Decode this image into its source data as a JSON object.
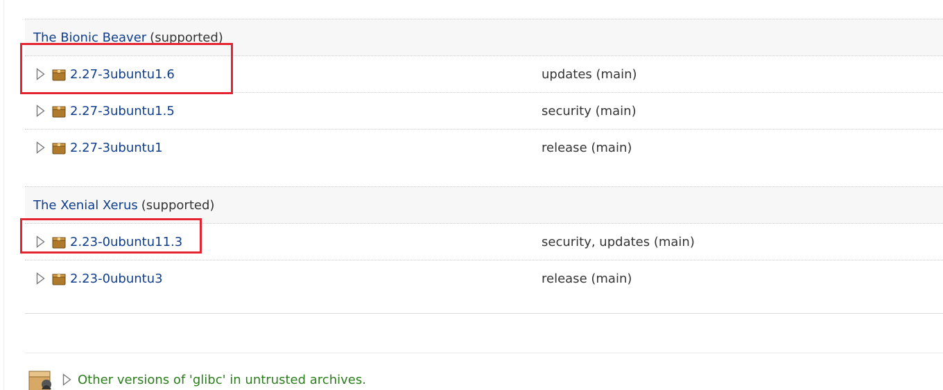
{
  "series": [
    {
      "name": "The Bionic Beaver",
      "status": "(supported)",
      "versions": [
        {
          "version": "2.27-3ubuntu1.6",
          "pocket": "updates (main)",
          "highlighted": true
        },
        {
          "version": "2.27-3ubuntu1.5",
          "pocket": "security (main)",
          "highlighted": false
        },
        {
          "version": "2.27-3ubuntu1",
          "pocket": "release (main)",
          "highlighted": false
        }
      ]
    },
    {
      "name": "The Xenial Xerus",
      "status": "(supported)",
      "versions": [
        {
          "version": "2.23-0ubuntu11.3",
          "pocket": "security, updates (main)",
          "highlighted": true
        },
        {
          "version": "2.23-0ubuntu3",
          "pocket": "release (main)",
          "highlighted": false
        }
      ]
    }
  ],
  "untrusted": {
    "label": "Other versions of 'glibc' in untrusted archives."
  },
  "icons": {
    "expander": "triangle-right-icon",
    "package": "package-box-icon",
    "untrusted": "untrusted-package-icon"
  },
  "colors": {
    "link": "#0f3d8c",
    "untrusted_link": "#2a7d1a",
    "highlight": "#e3232f",
    "header_bg": "#f7f7f7"
  }
}
